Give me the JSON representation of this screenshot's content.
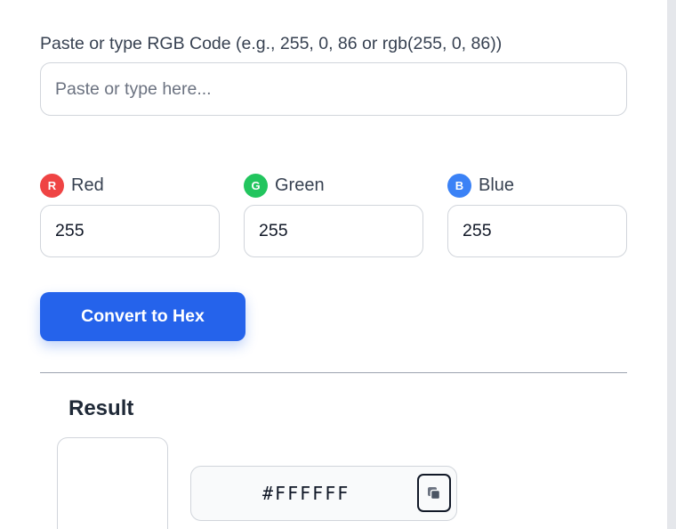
{
  "form": {
    "paste_label": "Paste or type RGB Code (e.g., 255, 0, 86 or rgb(255, 0, 86))",
    "paste_value": "",
    "paste_placeholder": "Paste or type here..."
  },
  "channels": [
    {
      "badge": "R",
      "label": "Red",
      "value": "255",
      "color": "#ef4444"
    },
    {
      "badge": "G",
      "label": "Green",
      "value": "255",
      "color": "#22c55e"
    },
    {
      "badge": "B",
      "label": "Blue",
      "value": "255",
      "color": "#3b82f6"
    }
  ],
  "convert_button": {
    "label": "Convert to Hex",
    "color": "#2563eb"
  },
  "result": {
    "title": "Result",
    "swatch_color": "#FFFFFF",
    "hex": "#FFFFFF",
    "copy_icon": "copy-icon"
  }
}
